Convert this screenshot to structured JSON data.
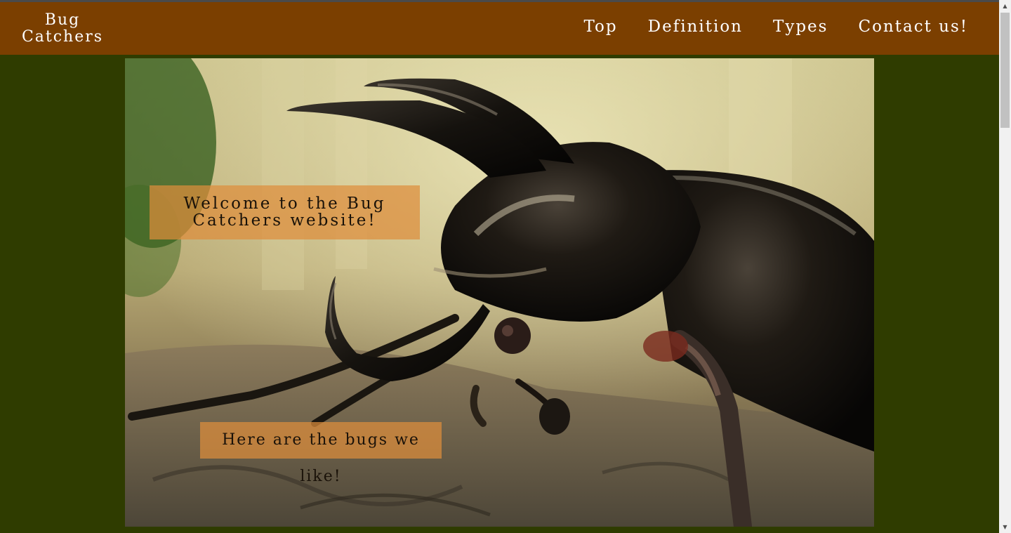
{
  "brand": {
    "line1": "Bug",
    "line2": "Catchers"
  },
  "nav": {
    "items": [
      "Top",
      "Definition",
      "Types",
      "Contact us!"
    ]
  },
  "hero": {
    "welcome_text": "Welcome to the Bug Catchers website!",
    "bugs_text": "Here are the bugs we like!"
  },
  "colors": {
    "navbar": "#7b3f00",
    "page_background": "#2f3c00",
    "caption_background": "#de8e3c"
  },
  "icons": {
    "scroll_up": "triangle-up-icon",
    "scroll_down": "triangle-down-icon"
  }
}
